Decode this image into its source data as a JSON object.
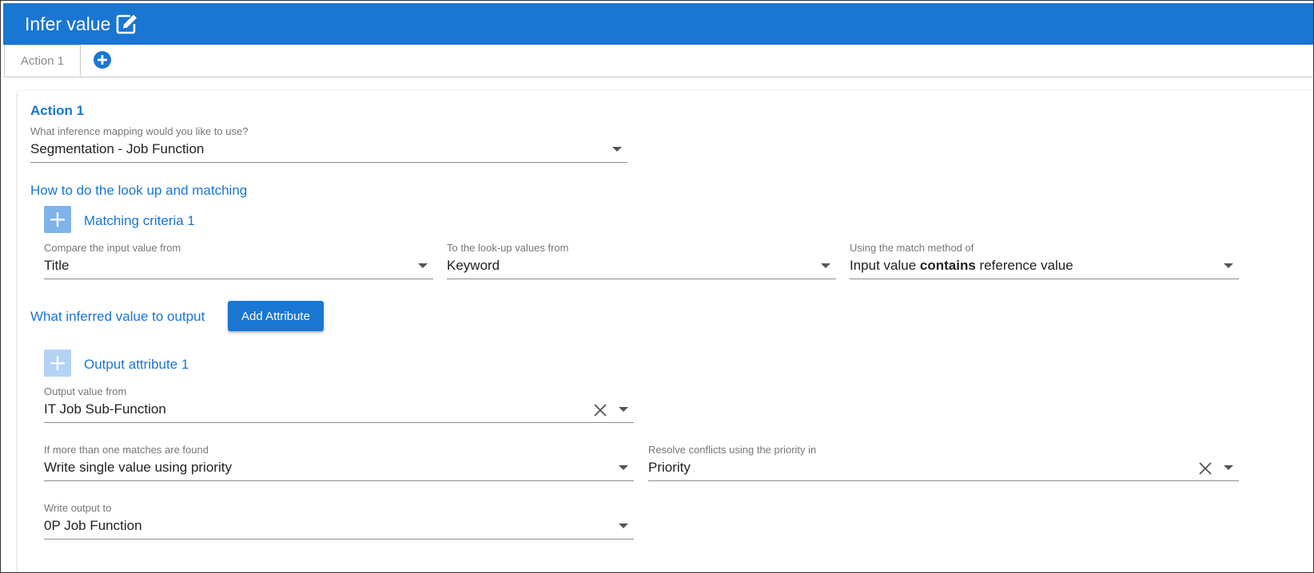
{
  "header": {
    "title": "Infer value",
    "edit_icon": "edit-square-icon"
  },
  "tabs": [
    {
      "label": "Action 1"
    }
  ],
  "add_tab_icon": "plus-circle-icon",
  "action": {
    "title": "Action 1",
    "mapping": {
      "label": "What inference mapping would you like to use?",
      "value": "Segmentation - Job Function"
    },
    "lookup_section": "How to do the look up and matching",
    "criteria": {
      "title": "Matching criteria 1",
      "compare": {
        "label": "Compare the input value from",
        "value": "Title"
      },
      "lookup": {
        "label": "To the look-up values from",
        "value": "Keyword"
      },
      "method": {
        "label": "Using the match method of",
        "value_pre": "Input value ",
        "value_bold": "contains",
        "value_post": " reference value"
      }
    },
    "output_section": "What inferred value to output",
    "add_attribute_label": "Add Attribute",
    "output_attr": {
      "title": "Output attribute 1",
      "value_from": {
        "label": "Output value from",
        "value": "IT Job Sub-Function"
      },
      "multiple": {
        "label": "If more than one matches are found",
        "value": "Write single value using priority"
      },
      "resolve": {
        "label": "Resolve conflicts using the priority in",
        "value": "Priority"
      },
      "write_to": {
        "label": "Write output to",
        "value": "0P Job Function"
      }
    }
  },
  "colors": {
    "primary": "#1976d2",
    "plus_box": "#7fb3ea",
    "plus_box_light": "#b3d3f4"
  }
}
